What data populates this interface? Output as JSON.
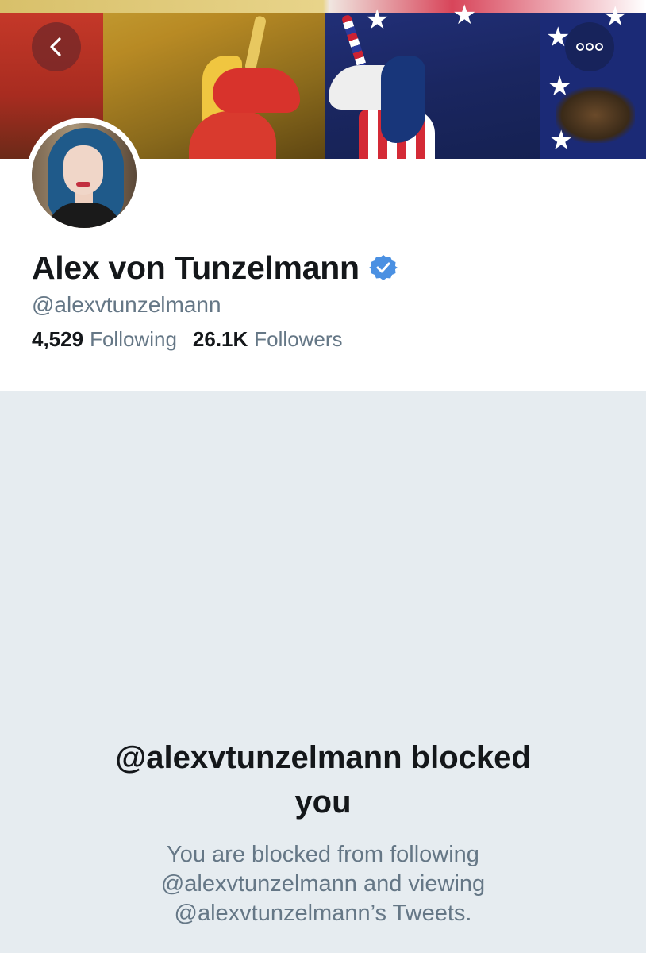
{
  "header": {
    "back_icon": "chevron-left-icon",
    "more_icon": "ellipsis-icon"
  },
  "profile": {
    "display_name": "Alex von Tunzelmann",
    "verified": true,
    "verified_color": "#4a90e2",
    "handle": "@alexvtunzelmann",
    "following_count": "4,529",
    "following_label": "Following",
    "followers_count": "26.1K",
    "followers_label": "Followers"
  },
  "blocked": {
    "title_line1": "@alexvtunzelmann blocked",
    "title_line2": "you",
    "desc_line1": "You are blocked from following",
    "desc_line2": "@alexvtunzelmann and viewing",
    "desc_line3": "@alexvtunzelmann’s Tweets."
  },
  "colors": {
    "page_bg": "#e6ecf0",
    "text_primary": "#14171a",
    "text_secondary": "#657786"
  }
}
